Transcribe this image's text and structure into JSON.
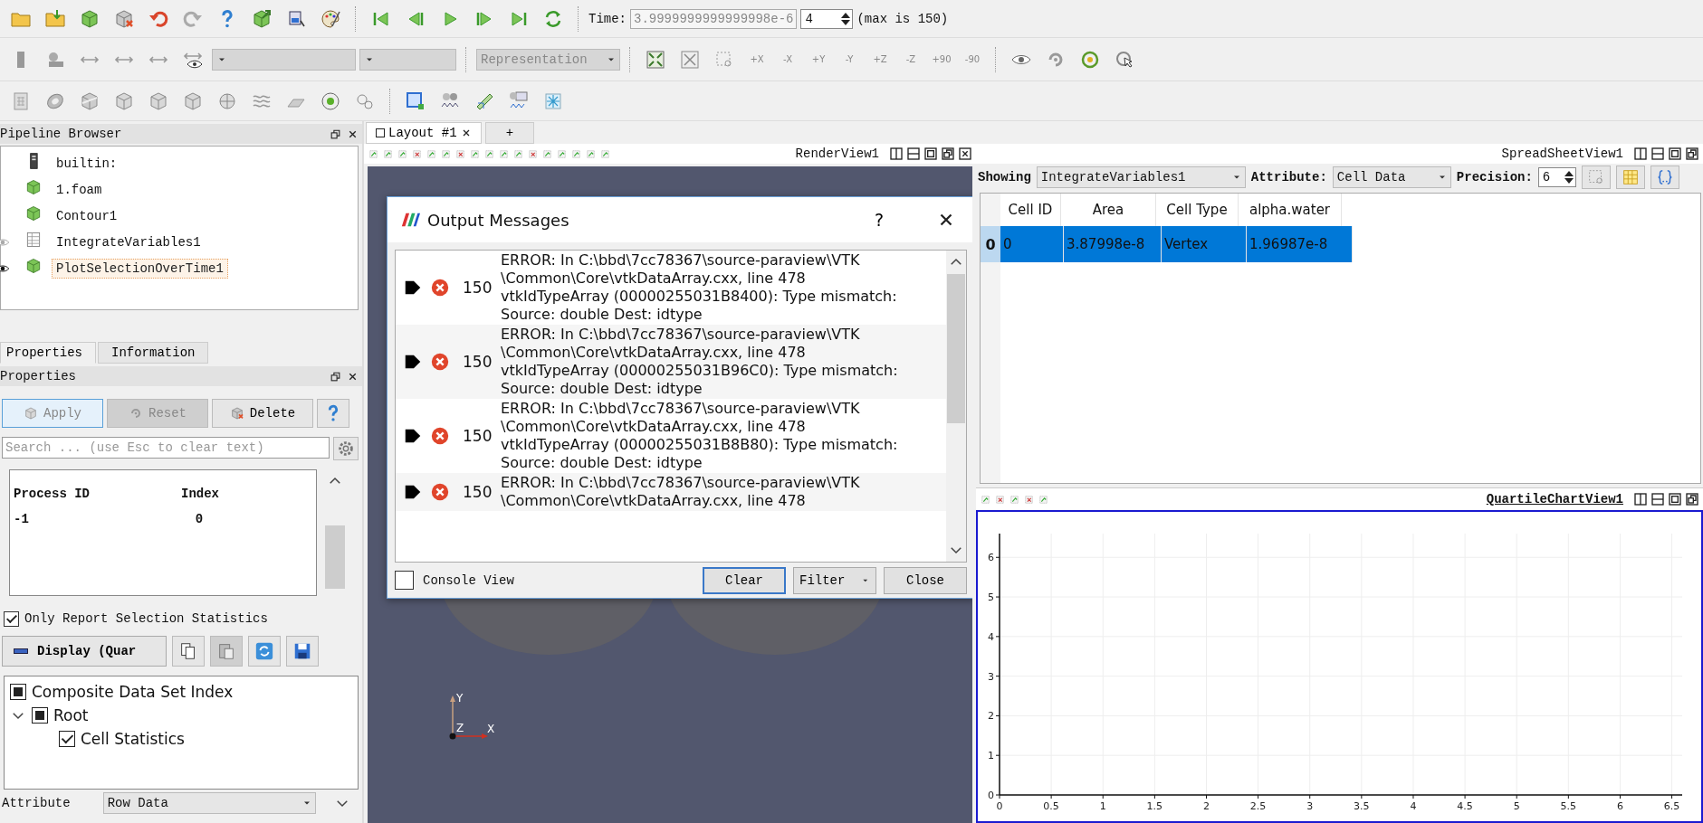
{
  "toolbar": {
    "time": {
      "label": "Time:",
      "value": "3.9999999999999998e-6",
      "step": "4",
      "max": "(max is 150)"
    },
    "representation": "Representation",
    "camera_axes": [
      "+X",
      "-X",
      "+Y",
      "-Y",
      "+Z",
      "-Z"
    ],
    "rotations": [
      "+90",
      "-90"
    ]
  },
  "pipeline_browser": {
    "title": "Pipeline Browser",
    "items": [
      {
        "label": "builtin:",
        "kind": "server",
        "visible": false,
        "selected": false
      },
      {
        "label": "1.foam",
        "kind": "source",
        "visible": false,
        "selected": false
      },
      {
        "label": "Contour1",
        "kind": "source",
        "visible": false,
        "selected": false
      },
      {
        "label": "IntegrateVariables1",
        "kind": "table",
        "visible": true,
        "selected": false
      },
      {
        "label": "PlotSelectionOverTime1",
        "kind": "source",
        "visible": true,
        "selected": true
      }
    ]
  },
  "panel_tabs": [
    {
      "label": "Properties",
      "selected": true
    },
    {
      "label": "Information",
      "selected": false
    }
  ],
  "properties": {
    "title": "Properties",
    "buttons": [
      {
        "label": "Apply",
        "kind": "apply",
        "highlighted": true,
        "disabled": true
      },
      {
        "label": "Reset",
        "kind": "reset",
        "highlighted": false,
        "disabled": true
      },
      {
        "label": "Delete",
        "kind": "delete",
        "highlighted": false,
        "disabled": false
      }
    ],
    "search": {
      "placeholder": "Search ... (use Esc to clear text)"
    },
    "selection_table": {
      "columns": [
        "Process ID",
        "Index"
      ],
      "rows": [
        [
          "-1",
          "0"
        ]
      ]
    },
    "only_report": {
      "label": "Only Report Selection Statistics",
      "checked": true
    },
    "display_button": "Display (Quar",
    "composite": {
      "header": {
        "label": "Composite Data Set Index",
        "checked": false,
        "partial": true
      },
      "items": [
        {
          "label": "Root",
          "checked": false,
          "partial": true,
          "expanded": true,
          "children": [
            {
              "label": "Cell Statistics",
              "checked": true
            }
          ]
        }
      ]
    },
    "attribute": {
      "label": "Attribute",
      "value": "Row Data"
    }
  },
  "layout_tabs": [
    {
      "label": "Layout #1",
      "selected": true
    },
    {
      "label": "+",
      "selected": false
    }
  ],
  "render_view": {
    "title": "RenderView1",
    "axes": [
      "Y",
      "Z",
      "X"
    ]
  },
  "dialog": {
    "title": "Output Messages",
    "help": "?",
    "messages": [
      {
        "count": "150",
        "lines": [
          "ERROR: In C:\\bbd\\7cc78367\\source-paraview\\VTK",
          "\\Common\\Core\\vtkDataArray.cxx, line 478",
          "vtkIdTypeArray (00000255031B8400): Type mismatch:",
          "Source: double Dest: idtype"
        ]
      },
      {
        "count": "150",
        "lines": [
          "ERROR: In C:\\bbd\\7cc78367\\source-paraview\\VTK",
          "\\Common\\Core\\vtkDataArray.cxx, line 478",
          "vtkIdTypeArray (00000255031B96C0): Type mismatch:",
          "Source: double Dest: idtype"
        ]
      },
      {
        "count": "150",
        "lines": [
          "ERROR: In C:\\bbd\\7cc78367\\source-paraview\\VTK",
          "\\Common\\Core\\vtkDataArray.cxx, line 478",
          "vtkIdTypeArray (00000255031B8B80): Type mismatch:",
          "Source: double Dest: idtype"
        ]
      },
      {
        "count": "150",
        "lines": [
          "ERROR: In C:\\bbd\\7cc78367\\source-paraview\\VTK",
          "\\Common\\Core\\vtkDataArray.cxx, line 478"
        ]
      }
    ],
    "console_view": {
      "label": "Console View",
      "checked": false
    },
    "buttons": [
      {
        "label": "Clear",
        "kind": "default"
      },
      {
        "label": "Filter",
        "kind": "menu"
      },
      {
        "label": "Close",
        "kind": "plain"
      }
    ]
  },
  "spreadsheet": {
    "title": "SpreadSheetView1",
    "showing_label": "Showing",
    "source": "IntegrateVariables1",
    "attribute_label": "Attribute:",
    "attribute": "Cell Data",
    "precision_label": "Precision:",
    "precision": "6",
    "columns": [
      "Cell ID",
      "Area",
      "Cell Type",
      "alpha.water"
    ],
    "rows": [
      {
        "header": "0",
        "cells": [
          "0",
          "3.87998e-8",
          "Vertex",
          "1.96987e-8"
        ],
        "selected": true
      }
    ]
  },
  "chart_view": {
    "title": "QuartileChartView1",
    "active": true,
    "chart_data": {
      "type": "line",
      "grid": true,
      "xlim": [
        0,
        6.6
      ],
      "ylim": [
        0,
        6.6
      ],
      "xticks": [
        0,
        0.5,
        1,
        1.5,
        2,
        2.5,
        3,
        3.5,
        4,
        4.5,
        5,
        5.5,
        6,
        6.5
      ],
      "yticks": [
        0,
        1,
        2,
        3,
        4,
        5,
        6
      ]
    }
  }
}
